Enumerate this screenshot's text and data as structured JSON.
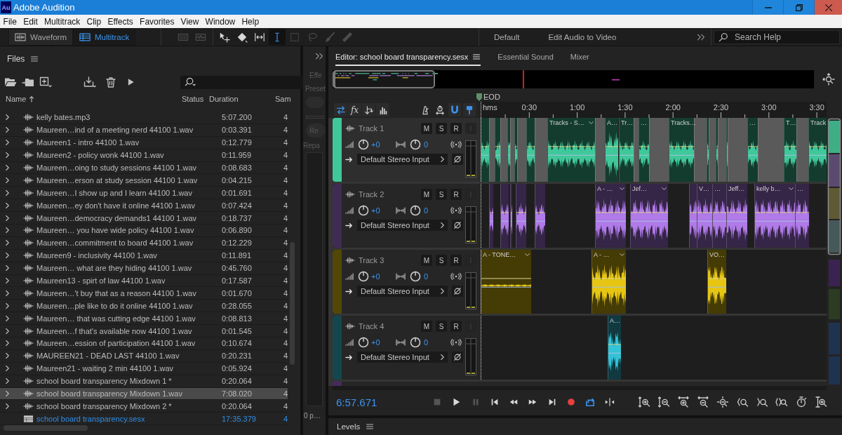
{
  "window": {
    "logo": "Au",
    "title": "Adobe Audition"
  },
  "menu": [
    "File",
    "Edit",
    "Multitrack",
    "Clip",
    "Effects",
    "Favorites",
    "View",
    "Window",
    "Help"
  ],
  "toolbar": {
    "views": [
      {
        "kind": "waveform",
        "label": "Waveform",
        "selected": false
      },
      {
        "kind": "multitrack",
        "label": "Multitrack",
        "selected": true
      }
    ],
    "tools": [
      {
        "kind": "spectral",
        "selected": false,
        "disabled": true
      },
      {
        "kind": "pitch",
        "selected": false,
        "disabled": true
      },
      {
        "kind": "move",
        "selected": false,
        "disabled": false
      },
      {
        "kind": "razor",
        "selected": false,
        "disabled": false
      },
      {
        "kind": "slip",
        "selected": false,
        "disabled": false
      },
      {
        "kind": "time-selection",
        "selected": true,
        "disabled": false
      },
      {
        "kind": "marquee",
        "selected": false,
        "disabled": true
      },
      {
        "kind": "lasso",
        "selected": false,
        "disabled": true
      },
      {
        "kind": "brush",
        "selected": false,
        "disabled": true
      },
      {
        "kind": "spot-healing",
        "selected": false,
        "disabled": true
      }
    ],
    "workspaces": [
      "Default",
      "Edit Audio to Video"
    ],
    "search": {
      "placeholder": "Search Help"
    }
  },
  "files": {
    "title": "Files",
    "columns": [
      "Name",
      "Status",
      "Duration",
      "Sam"
    ],
    "rows": [
      {
        "kind": "audio",
        "name": "kelly bates.mp3",
        "duration": "5:07.200",
        "column_4": "4",
        "selected": false
      },
      {
        "kind": "audio",
        "name": "Maureen…ind of a meeting nerd 44100 1.wav",
        "duration": "0:03.391",
        "column_4": "4",
        "selected": false
      },
      {
        "kind": "audio",
        "name": "Maureen1 - intro 44100 1.wav",
        "duration": "0:12.779",
        "column_4": "4",
        "selected": false
      },
      {
        "kind": "audio",
        "name": "Maureen2 - policy wonk 44100 1.wav",
        "duration": "0:11.959",
        "column_4": "4",
        "selected": false
      },
      {
        "kind": "audio",
        "name": "Maureen…oing to study sessions 44100 1.wav",
        "duration": "0:08.683",
        "column_4": "4",
        "selected": false
      },
      {
        "kind": "audio",
        "name": "Maureen…erson at study session 44100 1.wav",
        "duration": "0:04.215",
        "column_4": "4",
        "selected": false
      },
      {
        "kind": "audio",
        "name": "Maureen…I show up and I learn 44100 1.wav",
        "duration": "0:01.691",
        "column_4": "4",
        "selected": false
      },
      {
        "kind": "audio",
        "name": "Maureen…ey don't have it online 44100 1.wav",
        "duration": "0:07.424",
        "column_4": "4",
        "selected": false
      },
      {
        "kind": "audio",
        "name": "Maureen…democracy demands1 44100 1.wav",
        "duration": "0:18.737",
        "column_4": "4",
        "selected": false
      },
      {
        "kind": "audio",
        "name": "Maureen… you have wide policy 44100 1.wav",
        "duration": "0:06.890",
        "column_4": "4",
        "selected": false
      },
      {
        "kind": "audio",
        "name": "Maureen…commitment to board 44100 1.wav",
        "duration": "0:12.229",
        "column_4": "4",
        "selected": false
      },
      {
        "kind": "audio",
        "name": "Maureen9 - inclusivity 44100 1.wav",
        "duration": "0:11.891",
        "column_4": "4",
        "selected": false
      },
      {
        "kind": "audio",
        "name": "Maureen… what are they hiding 44100 1.wav",
        "duration": "0:45.760",
        "column_4": "4",
        "selected": false
      },
      {
        "kind": "audio",
        "name": "Maureen13 - spirt of law 44100 1.wav",
        "duration": "0:17.587",
        "column_4": "4",
        "selected": false
      },
      {
        "kind": "audio",
        "name": "Maureen…'t buy that as a reason 44100 1.wav",
        "duration": "0:01.670",
        "column_4": "4",
        "selected": false
      },
      {
        "kind": "audio",
        "name": "Maureen…ple like to do it online 44100 1.wav",
        "duration": "0:28.055",
        "column_4": "4",
        "selected": false
      },
      {
        "kind": "audio",
        "name": "Maureen… that was cutting edge 44100 1.wav",
        "duration": "0:08.813",
        "column_4": "4",
        "selected": false
      },
      {
        "kind": "audio",
        "name": "Maureen…f that's available now 44100 1.wav",
        "duration": "0:01.545",
        "column_4": "4",
        "selected": false
      },
      {
        "kind": "audio",
        "name": "Maureen…ession of participation 44100 1.wav",
        "duration": "0:10.674",
        "column_4": "4",
        "selected": false
      },
      {
        "kind": "audio",
        "name": "MAUREEN21 - DEAD LAST 44100 1.wav",
        "duration": "0:20.231",
        "column_4": "4",
        "selected": false
      },
      {
        "kind": "audio",
        "name": "Maureen21 - waiting 2 min 44100 1.wav",
        "duration": "0:05.924",
        "column_4": "4",
        "selected": false
      },
      {
        "kind": "audio",
        "name": "school board transparency Mixdown 1 *",
        "duration": "0:20.064",
        "column_4": "4",
        "selected": false
      },
      {
        "kind": "audio",
        "name": "school board transparency Mixdown 1.wav",
        "duration": "7:08.020",
        "column_4": "4",
        "selected": true
      },
      {
        "kind": "audio",
        "name": "school board transparency Mixdown 2 *",
        "duration": "0:20.064",
        "column_4": "4",
        "selected": false
      },
      {
        "kind": "session",
        "name": "school board transparency.sesx",
        "duration": "17:35.379",
        "column_4": "4",
        "selected": false
      }
    ]
  },
  "side_panel": {
    "heading": "Effe",
    "label": "Preset",
    "button": "Re",
    "caption": "Repa",
    "footer": "0 p…"
  },
  "editor": {
    "tabs": [
      {
        "label": "Editor: school board transparency.sesx",
        "selected": true
      },
      {
        "label": "Essential Sound",
        "selected": false
      },
      {
        "label": "Mixer",
        "selected": false
      }
    ],
    "marker": "EOD",
    "track_tools": [
      {
        "kind": "inputs-outputs",
        "on": true
      },
      {
        "kind": "effects",
        "label": "fx",
        "on": false
      },
      {
        "kind": "sends",
        "on": false
      },
      {
        "kind": "eq",
        "on": false
      },
      {
        "kind": "metronome",
        "on": false
      },
      {
        "kind": "timer",
        "on": false
      },
      {
        "kind": "snap",
        "on": true
      },
      {
        "kind": "marker",
        "on": true
      }
    ],
    "ruler": {
      "unit": "hms",
      "labels": [
        "0:30",
        "1:00",
        "1:30",
        "2:00",
        "2:30",
        "3:00",
        "3:30"
      ]
    },
    "tracks": [
      {
        "name": "Track 1",
        "selected": true,
        "color": "#40c89b",
        "controls": [
          {
            "label": "M",
            "on": false,
            "disabled": false
          },
          {
            "label": "S",
            "on": false,
            "disabled": false
          },
          {
            "label": "R",
            "on": false,
            "disabled": false
          },
          {
            "label": "I",
            "on": false,
            "disabled": true
          }
        ],
        "volume": "+0",
        "pan": "0",
        "input": "Default Stereo Input",
        "clips": [
          "Tracks - S…",
          "A…",
          "Tr…",
          "…",
          "Tracks…",
          "…",
          "T…",
          "Track"
        ]
      },
      {
        "name": "Track 2",
        "selected": false,
        "color": "#b07ae8",
        "controls": [
          {
            "label": "M",
            "on": false,
            "disabled": false
          },
          {
            "label": "S",
            "on": false,
            "disabled": false
          },
          {
            "label": "R",
            "on": false,
            "disabled": false
          },
          {
            "label": "I",
            "on": false,
            "disabled": true
          }
        ],
        "volume": "+0",
        "pan": "0",
        "input": "Default Stereo Input",
        "clips": [
          "A - …",
          "Jef…",
          "V…",
          "…",
          "Jeff…",
          "kelly b…",
          "…"
        ]
      },
      {
        "name": "Track 3",
        "selected": false,
        "color": "#e6c612",
        "controls": [
          {
            "label": "M",
            "on": false,
            "disabled": false
          },
          {
            "label": "S",
            "on": false,
            "disabled": false
          },
          {
            "label": "R",
            "on": false,
            "disabled": false
          },
          {
            "label": "I",
            "on": false,
            "disabled": true
          }
        ],
        "volume": "+0",
        "pan": "0",
        "input": "Default Stereo Input",
        "clips": [
          "A - TONE…",
          "A - …",
          "VO…"
        ]
      },
      {
        "name": "Track 4",
        "selected": false,
        "color": "#34c2d6",
        "controls": [
          {
            "label": "M",
            "on": false,
            "disabled": false
          },
          {
            "label": "S",
            "on": false,
            "disabled": false
          },
          {
            "label": "R",
            "on": false,
            "disabled": false
          },
          {
            "label": "I",
            "on": false,
            "disabled": true
          }
        ],
        "volume": "+0",
        "pan": "0",
        "input": "Default Stereo Input",
        "clips": [
          "A…"
        ]
      }
    ],
    "time": "6:57.671",
    "transport": [
      {
        "kind": "stop",
        "on": false,
        "disabled": true
      },
      {
        "kind": "play",
        "on": false,
        "disabled": false
      },
      {
        "kind": "pause",
        "on": false,
        "disabled": true
      },
      {
        "kind": "go-to-start",
        "on": false,
        "disabled": false
      },
      {
        "kind": "rewind",
        "on": false,
        "disabled": false
      },
      {
        "kind": "fast-forward",
        "on": false,
        "disabled": false
      },
      {
        "kind": "go-to-end",
        "on": false,
        "disabled": false
      },
      {
        "kind": "record",
        "on": false,
        "disabled": false
      },
      {
        "kind": "loop",
        "on": true,
        "disabled": false
      },
      {
        "kind": "skip-selection",
        "on": false,
        "disabled": false
      }
    ]
  },
  "levels": {
    "title": "Levels"
  }
}
